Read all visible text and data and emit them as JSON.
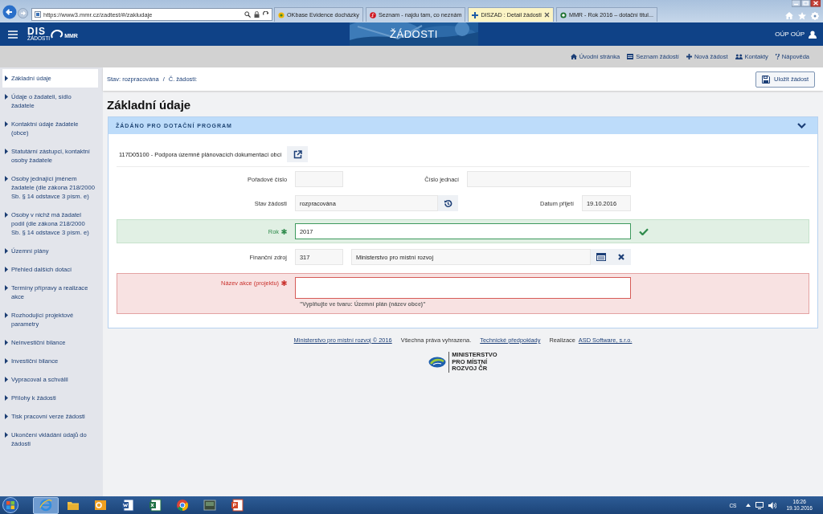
{
  "browser": {
    "address": "https://www3.mmr.cz/zadtest/#/zakludaje",
    "tabs": [
      {
        "kind": "okbase",
        "title": "OKbase Evidence docházky",
        "selected": false
      },
      {
        "kind": "seznam",
        "title": "Seznam - najdu tam, co neznám",
        "selected": false
      },
      {
        "kind": "dis",
        "title": "DISZAD : Detail žádosti",
        "selected": true
      },
      {
        "kind": "mmr",
        "title": "MMR - Rok 2016 – dotační titul...",
        "selected": false
      }
    ]
  },
  "header": {
    "logo": "DIS",
    "logo_sub": "ŽÁDOSTI",
    "logo_mark": "MMR",
    "title": "ŽÁDOSTI",
    "user": "OÚP OÚP"
  },
  "nav": [
    {
      "kind": "home",
      "label": "Úvodní stránka"
    },
    {
      "kind": "list",
      "label": "Seznam žádostí"
    },
    {
      "kind": "add",
      "label": "Nová žádost"
    },
    {
      "kind": "people",
      "label": "Kontakty"
    },
    {
      "kind": "help",
      "label": "Nápověda"
    }
  ],
  "sidebar": {
    "items": [
      {
        "label": "Základní údaje",
        "selected": true
      },
      {
        "label": "Údaje o žadateli, sídlo žadatele",
        "selected": false
      },
      {
        "label": "Kontaktní údaje žadatele (obce)",
        "selected": false
      },
      {
        "label": "Statutární zástupci, kontaktní osoby žadatele",
        "selected": false
      },
      {
        "label": "Osoby jednající jménem žadatele (dle zákona 218/2000 Sb. § 14 odstavce 3 písm. e)",
        "selected": false
      },
      {
        "label": "Osoby v nichž má žadatel podíl (dle zákona 218/2000 Sb. § 14 odstavce 3 písm. e)",
        "selected": false
      },
      {
        "label": "Územní plány",
        "selected": false
      },
      {
        "label": "Přehled dalších dotací",
        "selected": false
      },
      {
        "label": "Termíny přípravy a realizace akce",
        "selected": false
      },
      {
        "label": "Rozhodující projektové parametry",
        "selected": false
      },
      {
        "label": "Neinvestiční bilance",
        "selected": false
      },
      {
        "label": "Investiční bilance",
        "selected": false
      },
      {
        "label": "Vypracoval a schválil",
        "selected": false
      },
      {
        "label": "Přílohy k žádosti",
        "selected": false
      },
      {
        "label": "Tisk pracovní verze žádosti",
        "selected": false
      },
      {
        "label": "Ukončení vkládání údajů do žádosti",
        "selected": false
      }
    ]
  },
  "toolbar": {
    "status": "Stav: rozpracována",
    "separator": "/",
    "number_label": "Č. žádosti:",
    "save": "Uložit žádost"
  },
  "heading": "Základní údaje",
  "section": {
    "title": "ŽÁDÁNO PRO DOTAČNÍ PROGRAM",
    "expanded": true,
    "program": "117D05100 - Podpora územně plánovacích dokumentací obcí",
    "rows": [
      {
        "kind": "pair",
        "items": [
          {
            "label": "Pořadové číslo"
          },
          {
            "label": "Číslo jednací"
          }
        ]
      },
      {
        "kind": "status",
        "items": [
          {
            "label": "Stav žádosti",
            "value": "rozpracována"
          },
          {
            "label": "Datum přijetí",
            "value": "19.10.2016"
          }
        ]
      },
      {
        "kind": "wide",
        "label": "Rok",
        "value": "2017",
        "required": true,
        "valid": true
      },
      {
        "kind": "source",
        "label": "Finanční zdroj",
        "code": "317",
        "value": "Ministerstvo pro místní rozvoj"
      },
      {
        "kind": "wide",
        "label": "Název akce (projektu)",
        "required": true,
        "valid": false,
        "hint": "\"Vyplňujte ve tvaru: Územní plán (název obce)\""
      }
    ]
  },
  "footer": {
    "items": [
      {
        "kind": "link",
        "text": "Ministerstvo pro místní rozvoj © 2016"
      },
      {
        "kind": "plain",
        "text": "Všechna práva vyhrazena."
      },
      {
        "kind": "link",
        "text": "Technické předpoklady"
      },
      {
        "kind": "plain",
        "text": "Realizace"
      },
      {
        "kind": "link",
        "text": "ASD Software, s.r.o."
      }
    ],
    "logo_text": [
      "MINISTERSTVO",
      "PRO MÍSTNÍ",
      "ROZVOJ ČR"
    ]
  },
  "taskbar": {
    "apps": [
      {
        "kind": "ie",
        "selected": true
      },
      {
        "kind": "explorer",
        "selected": false
      },
      {
        "kind": "outlook",
        "selected": false
      },
      {
        "kind": "word",
        "selected": false
      },
      {
        "kind": "excel",
        "selected": false
      },
      {
        "kind": "chrome",
        "selected": false
      },
      {
        "kind": "app",
        "selected": false
      },
      {
        "kind": "powerpoint",
        "selected": false
      }
    ],
    "language": "CS",
    "time": "16:26",
    "date": "19.10.2016"
  }
}
